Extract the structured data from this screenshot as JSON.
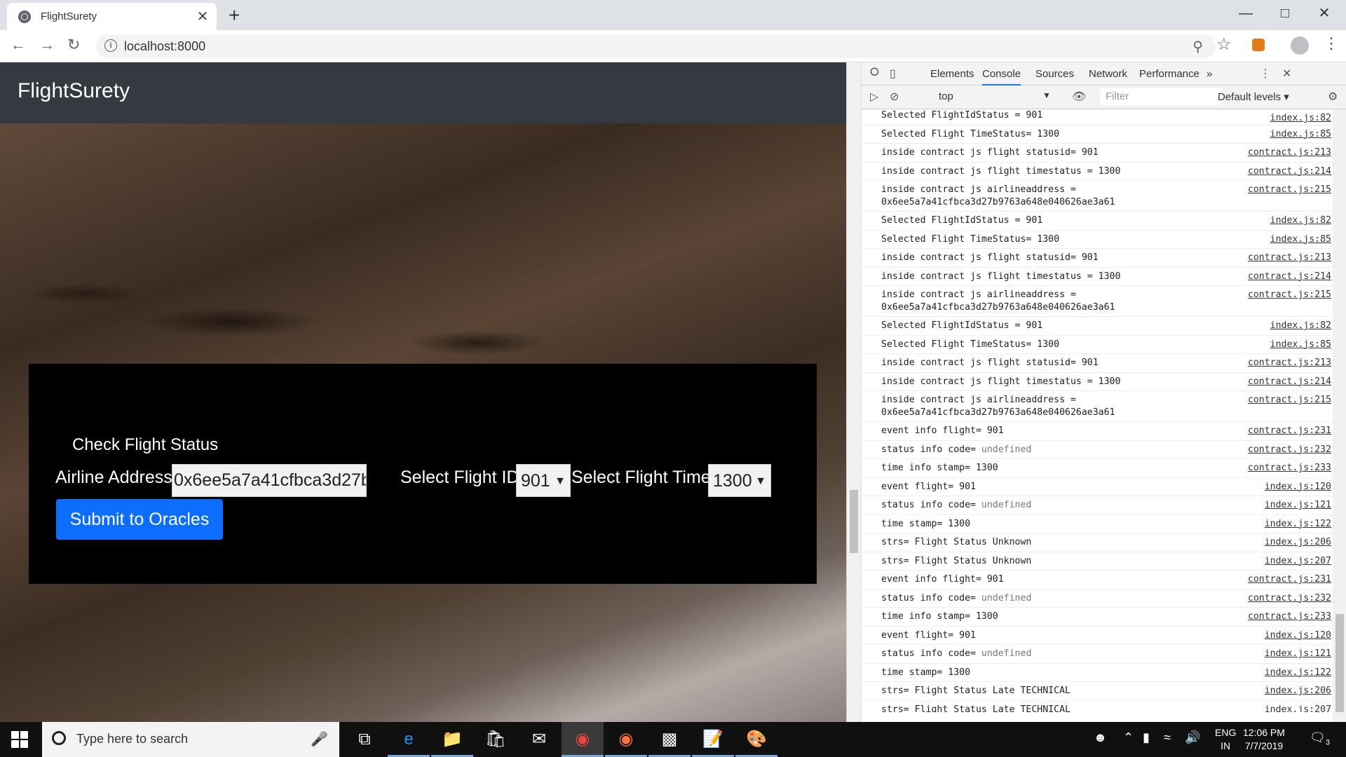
{
  "browser": {
    "tab_title": "FlightSurety",
    "url": "localhost:8000",
    "new_tab": "+",
    "close_tab": "✕"
  },
  "page": {
    "brand": "FlightSurety",
    "panel_title": "Check Flight Status",
    "airline_label": "Airline Address",
    "airline_value": "0x6ee5a7a41cfbca3d27b",
    "flight_id_label": "Select Flight ID",
    "flight_id_value": "901",
    "flight_time_label": "Select Flight Time",
    "flight_time_value": "1300",
    "submit_label": "Submit to Oracles"
  },
  "devtools": {
    "tabs": [
      "Elements",
      "Console",
      "Sources",
      "Network",
      "Performance"
    ],
    "active_tab": "Console",
    "more": "»",
    "context": "top",
    "filter_placeholder": "Filter",
    "levels": "Default levels ▾",
    "partial_top": {
      "msg": "Selected FlightIdStatus = 901",
      "src": "index.js:82"
    },
    "rows": [
      {
        "msg": "Selected Flight TimeStatus= 1300",
        "src": "index.js:85"
      },
      {
        "msg": "inside contract js flight statusid= 901",
        "src": "contract.js:213"
      },
      {
        "msg": "inside contract js flight timestatus = 1300",
        "src": "contract.js:214"
      },
      {
        "msg": "inside contract js airlineaddress =\n0x6ee5a7a41cfbca3d27b9763a648e040626ae3a61",
        "src": "contract.js:215"
      },
      {
        "msg": "Selected FlightIdStatus = 901",
        "src": "index.js:82"
      },
      {
        "msg": "Selected Flight TimeStatus= 1300",
        "src": "index.js:85"
      },
      {
        "msg": "inside contract js flight statusid= 901",
        "src": "contract.js:213"
      },
      {
        "msg": "inside contract js flight timestatus = 1300",
        "src": "contract.js:214"
      },
      {
        "msg": "inside contract js airlineaddress =\n0x6ee5a7a41cfbca3d27b9763a648e040626ae3a61",
        "src": "contract.js:215"
      },
      {
        "msg": "Selected FlightIdStatus = 901",
        "src": "index.js:82"
      },
      {
        "msg": "Selected Flight TimeStatus= 1300",
        "src": "index.js:85"
      },
      {
        "msg": "inside contract js flight statusid= 901",
        "src": "contract.js:213"
      },
      {
        "msg": "inside contract js flight timestatus = 1300",
        "src": "contract.js:214"
      },
      {
        "msg": "inside contract js airlineaddress =\n0x6ee5a7a41cfbca3d27b9763a648e040626ae3a61",
        "src": "contract.js:215"
      },
      {
        "msg": "event info flight= 901",
        "src": "contract.js:231"
      },
      {
        "msg": "status info code= ",
        "und": "undefined",
        "src": "contract.js:232"
      },
      {
        "msg": "time info stamp= 1300",
        "src": "contract.js:233"
      },
      {
        "msg": "event flight= 901",
        "src": "index.js:120"
      },
      {
        "msg": "status info code= ",
        "und": "undefined",
        "src": "index.js:121"
      },
      {
        "msg": "time stamp= 1300",
        "src": "index.js:122"
      },
      {
        "msg": "strs= Flight Status Unknown",
        "src": "index.js:206"
      },
      {
        "msg": "strs= Flight Status Unknown",
        "src": "index.js:207"
      },
      {
        "msg": "event info flight= 901",
        "src": "contract.js:231"
      },
      {
        "msg": "status info code= ",
        "und": "undefined",
        "src": "contract.js:232"
      },
      {
        "msg": "time info stamp= 1300",
        "src": "contract.js:233"
      },
      {
        "msg": "event flight= 901",
        "src": "index.js:120"
      },
      {
        "msg": "status info code= ",
        "und": "undefined",
        "src": "index.js:121"
      },
      {
        "msg": "time stamp= 1300",
        "src": "index.js:122"
      },
      {
        "msg": "strs= Flight Status Late TECHNICAL",
        "src": "index.js:206"
      },
      {
        "msg": "strs= Flight Status Late TECHNICAL",
        "src": "index.js:207"
      }
    ],
    "prompt": "›"
  },
  "taskbar": {
    "search_placeholder": "Type here to search",
    "lang_top": "ENG",
    "lang_bottom": "IN",
    "time": "12:06 PM",
    "date": "7/7/2019",
    "notifications": "3"
  }
}
